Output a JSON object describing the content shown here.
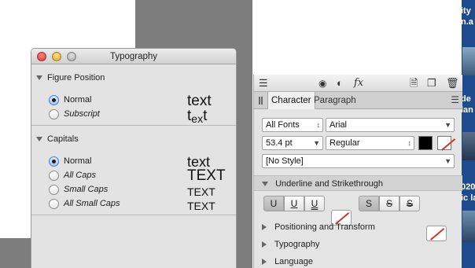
{
  "typography_window": {
    "title": "Typography",
    "figure_position": {
      "heading": "Figure Position",
      "options": [
        "Normal",
        "Subscript"
      ],
      "selected": "Normal",
      "samples": [
        "text",
        "text"
      ]
    },
    "capitals": {
      "heading": "Capitals",
      "options": [
        "Normal",
        "All Caps",
        "Small Caps",
        "All Small Caps"
      ],
      "selected": "Normal",
      "samples": [
        "text",
        "TEXT",
        "TEXT",
        "TEXT"
      ]
    }
  },
  "character_panel": {
    "tabs": [
      "Character",
      "Paragraph"
    ],
    "active_tab": "Character",
    "font_collection": "All Fonts",
    "font_family": "Arial",
    "font_size": "53.4 pt",
    "font_style": "Regular",
    "text_color": "#000000",
    "paragraph_style": "[No Style]",
    "sections": {
      "underline": "Underline and Strikethrough",
      "positioning": "Positioning and Transform",
      "typography": "Typography",
      "language": "Language"
    },
    "underline_buttons": [
      "U",
      "U",
      "U"
    ],
    "strike_buttons": [
      "S",
      "S",
      "S"
    ]
  },
  "desktop": {
    "labels": [
      "ity",
      "n.a",
      "de",
      "lan",
      "020",
      "ic la"
    ]
  }
}
